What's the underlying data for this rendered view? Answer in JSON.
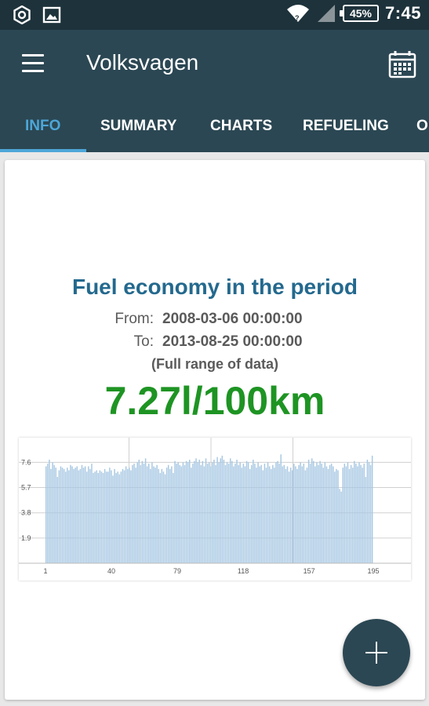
{
  "status_bar": {
    "time": "7:45",
    "battery": "45%",
    "icons": [
      "settings-ring-icon",
      "image-icon",
      "wifi-icon",
      "signal-icon",
      "battery-icon"
    ]
  },
  "app_bar": {
    "title": "Volksvagen",
    "icons": [
      "menu-icon",
      "calendar-icon"
    ]
  },
  "tabs": [
    {
      "label": "INFO",
      "active": true
    },
    {
      "label": "SUMMARY",
      "active": false
    },
    {
      "label": "CHARTS",
      "active": false
    },
    {
      "label": "REFUELING",
      "active": false
    },
    {
      "label": "O",
      "active": false
    }
  ],
  "info_card": {
    "title": "Fuel economy in the period",
    "from_label": "From:",
    "from_value": "2008-03-06 00:00:00",
    "to_label": "To:",
    "to_value": "2013-08-25 00:00:00",
    "range_note": "(Full range of data)",
    "economy_value": "7.27l/100km"
  },
  "colors": {
    "primary": "#2b4753",
    "status_bar": "#1e323b",
    "accent": "#4da6d8",
    "title_blue": "#24698e",
    "economy_green": "#1e9423",
    "bar_blue": "#a8c8e3"
  },
  "chart_data": {
    "type": "bar",
    "x_ticks": [
      "1",
      "40",
      "79",
      "118",
      "157",
      "195"
    ],
    "y_ticks": [
      "1.9",
      "3.8",
      "5.7",
      "7.6"
    ],
    "ylim": [
      0,
      9.1
    ],
    "xlim": [
      1,
      195
    ],
    "values": [
      7.3,
      7.5,
      7.8,
      7.1,
      7.6,
      7.4,
      7.2,
      6.5,
      7.0,
      7.3,
      7.2,
      7.1,
      6.9,
      7.2,
      7.0,
      7.4,
      7.3,
      7.1,
      7.2,
      7.3,
      7.0,
      7.1,
      7.4,
      7.2,
      7.3,
      6.9,
      7.3,
      7.1,
      7.5,
      6.8,
      6.9,
      7.0,
      6.8,
      7.0,
      6.9,
      6.8,
      7.1,
      6.9,
      6.9,
      7.2,
      7.0,
      6.6,
      7.1,
      6.8,
      6.9,
      6.7,
      6.9,
      7.1,
      7.0,
      7.3,
      7.1,
      7.2,
      7.0,
      7.4,
      7.5,
      7.2,
      7.6,
      7.8,
      7.4,
      7.7,
      7.5,
      7.9,
      7.3,
      7.5,
      7.1,
      7.6,
      7.3,
      7.2,
      7.4,
      7.1,
      6.8,
      7.1,
      6.9,
      6.7,
      7.2,
      7.4,
      7.1,
      7.3,
      6.8,
      7.7,
      7.5,
      7.6,
      7.4,
      7.3,
      7.6,
      7.4,
      7.7,
      7.6,
      7.8,
      7.2,
      7.5,
      7.7,
      7.9,
      7.6,
      7.8,
      7.4,
      7.7,
      7.3,
      7.9,
      7.5,
      7.6,
      7.3,
      7.6,
      7.8,
      7.4,
      8.0,
      7.6,
      7.9,
      8.1,
      7.8,
      7.4,
      7.6,
      7.5,
      7.9,
      7.7,
      7.3,
      7.5,
      7.8,
      7.4,
      7.6,
      7.2,
      7.5,
      7.3,
      7.7,
      7.6,
      7.1,
      7.4,
      7.8,
      7.5,
      7.2,
      7.6,
      7.3,
      7.4,
      7.0,
      7.5,
      7.2,
      7.6,
      7.3,
      7.1,
      7.4,
      7.2,
      7.6,
      7.7,
      7.5,
      8.2,
      7.3,
      7.4,
      7.1,
      7.3,
      6.9,
      7.2,
      7.0,
      7.5,
      7.3,
      7.1,
      7.4,
      7.6,
      7.3,
      7.5,
      7.0,
      7.2,
      7.8,
      7.5,
      7.9,
      7.7,
      7.3,
      7.6,
      7.4,
      7.7,
      7.5,
      7.2,
      7.6,
      7.3,
      7.1,
      7.4,
      7.5,
      7.3,
      6.9,
      7.1,
      7.0,
      5.6,
      5.4,
      7.2,
      7.5,
      7.3,
      7.6,
      7.1,
      7.4,
      7.2,
      7.7,
      7.5,
      7.3,
      7.6,
      7.4,
      7.2,
      7.5,
      6.5,
      7.8,
      7.6,
      7.4,
      8.1
    ]
  }
}
